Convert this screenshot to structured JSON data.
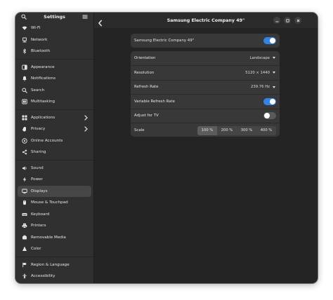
{
  "sidebar": {
    "title": "Settings",
    "items": [
      {
        "label": "Wi-Fi",
        "icon": "wifi-icon"
      },
      {
        "label": "Network",
        "icon": "network-icon"
      },
      {
        "label": "Bluetooth",
        "icon": "bluetooth-icon"
      },
      {
        "label": "Appearance",
        "icon": "appearance-icon"
      },
      {
        "label": "Notifications",
        "icon": "bell-icon"
      },
      {
        "label": "Search",
        "icon": "search-icon"
      },
      {
        "label": "Multitasking",
        "icon": "multitasking-icon"
      },
      {
        "label": "Applications",
        "icon": "applications-icon"
      },
      {
        "label": "Privacy",
        "icon": "hand-icon"
      },
      {
        "label": "Online Accounts",
        "icon": "accounts-icon"
      },
      {
        "label": "Sharing",
        "icon": "share-icon"
      },
      {
        "label": "Sound",
        "icon": "speaker-icon"
      },
      {
        "label": "Power",
        "icon": "power-icon"
      },
      {
        "label": "Displays",
        "icon": "display-icon"
      },
      {
        "label": "Mouse & Touchpad",
        "icon": "mouse-icon"
      },
      {
        "label": "Keyboard",
        "icon": "keyboard-icon"
      },
      {
        "label": "Printers",
        "icon": "printer-icon"
      },
      {
        "label": "Removable Media",
        "icon": "media-icon"
      },
      {
        "label": "Color",
        "icon": "color-icon"
      },
      {
        "label": "Region & Language",
        "icon": "flag-icon"
      },
      {
        "label": "Accessibility",
        "icon": "accessibility-icon"
      }
    ]
  },
  "main": {
    "title": "Samsung Electric Company 49\""
  },
  "monitor_card": {
    "label": "Samsung Electric Company 49\"",
    "enabled": true
  },
  "settings": {
    "orientation": {
      "label": "Orientation",
      "value": "Landscape"
    },
    "resolution": {
      "label": "Resolution",
      "value": "5120 × 1440"
    },
    "refresh_rate": {
      "label": "Refresh Rate",
      "value": "239.76 Hz"
    },
    "vrr": {
      "label": "Variable Refresh Rate",
      "enabled": true
    },
    "adjust_tv": {
      "label": "Adjust for TV",
      "enabled": false
    },
    "scale": {
      "label": "Scale",
      "options": [
        "100 %",
        "200 %",
        "300 %",
        "400 %"
      ],
      "selected": "100 %"
    }
  },
  "colors": {
    "accent": "#3584e4",
    "sidebar_bg": "#303030",
    "content_bg": "#242424",
    "card_bg": "#383838"
  }
}
